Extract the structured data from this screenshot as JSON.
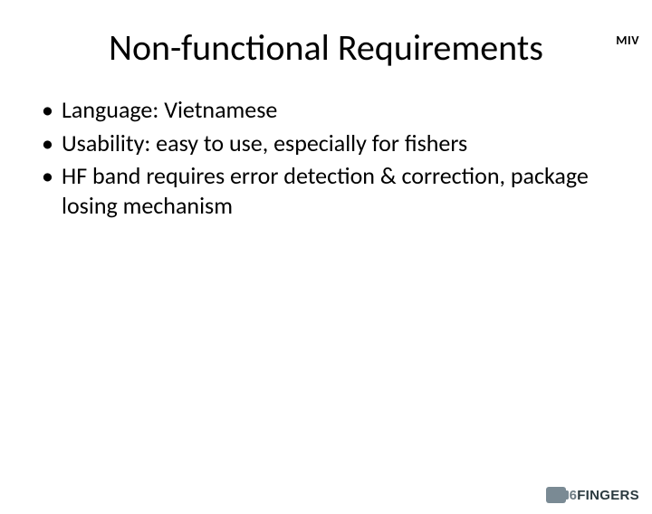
{
  "corner_brand": "MIV",
  "title": "Non-functional Requirements",
  "bullets": [
    "Language: Vietnamese",
    "Usability: easy to use, especially for fishers",
    "HF band requires error detection & correction, package losing mechanism"
  ],
  "footer_logo": {
    "six": "6",
    "rest": "FINGERS"
  }
}
